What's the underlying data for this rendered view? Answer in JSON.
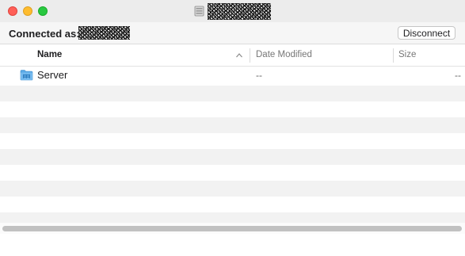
{
  "window": {
    "title_icon": "server-icon",
    "title_text_redacted": true
  },
  "toolbar": {
    "connected_label": "Connected as:",
    "disconnect_label": "Disconnect"
  },
  "columns": {
    "name": "Name",
    "date_modified": "Date Modified",
    "size": "Size",
    "sort_indicator": "ascending"
  },
  "files": [
    {
      "icon": "network-folder-icon",
      "name": "Server",
      "date_modified": "--",
      "size": "--"
    }
  ],
  "colors": {
    "close": "#ff5f57",
    "minimize": "#febc2e",
    "maximize": "#28c840",
    "folder": "#5aa9e6",
    "stripe": "#f2f2f2"
  }
}
